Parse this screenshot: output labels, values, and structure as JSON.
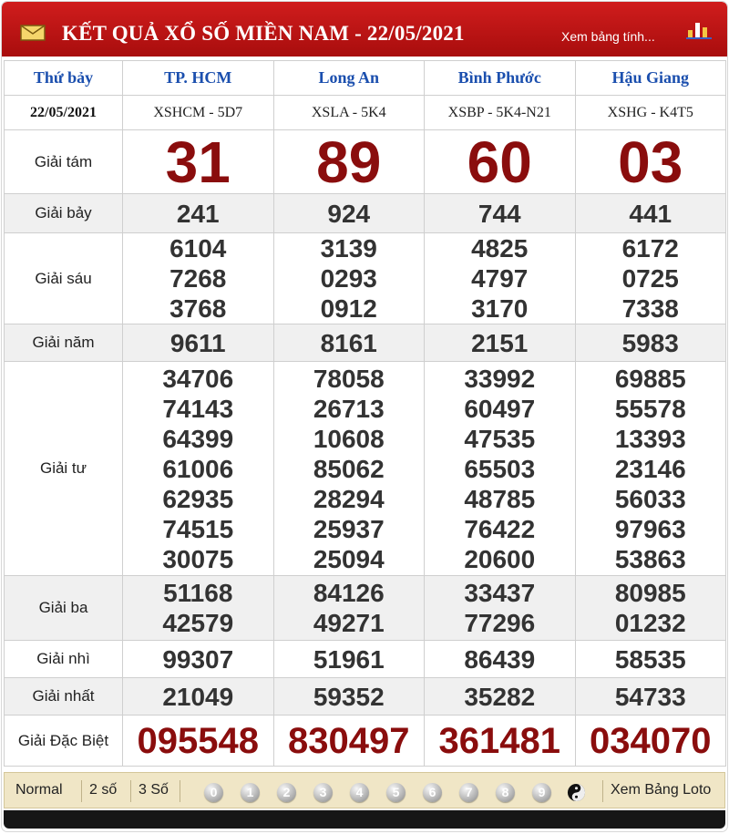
{
  "header": {
    "title": "KẾT QUẢ XỔ SỐ MIỀN NAM - 22/05/2021",
    "view_table": "Xem bảng tính...",
    "icons": [
      "mail-icon",
      "bar-chart-icon"
    ]
  },
  "columns": {
    "day": "Thứ bảy",
    "provinces": [
      "TP. HCM",
      "Long An",
      "Bình Phước",
      "Hậu Giang"
    ]
  },
  "codes": {
    "date": "22/05/2021",
    "tickets": [
      "XSHCM - 5D7",
      "XSLA - 5K4",
      "XSBP - 5K4-N21",
      "XSHG - K4T5"
    ]
  },
  "prizes": {
    "g8": {
      "label": "Giải tám",
      "values": [
        "31",
        "89",
        "60",
        "03"
      ]
    },
    "g7": {
      "label": "Giải bảy",
      "values": [
        "241",
        "924",
        "744",
        "441"
      ]
    },
    "g6": {
      "label": "Giải sáu",
      "values": [
        [
          "6104",
          "7268",
          "3768"
        ],
        [
          "3139",
          "0293",
          "0912"
        ],
        [
          "4825",
          "4797",
          "3170"
        ],
        [
          "6172",
          "0725",
          "7338"
        ]
      ]
    },
    "g5": {
      "label": "Giải năm",
      "values": [
        "9611",
        "8161",
        "2151",
        "5983"
      ]
    },
    "g4": {
      "label": "Giải tư",
      "values": [
        [
          "34706",
          "74143",
          "64399",
          "61006",
          "62935",
          "74515",
          "30075"
        ],
        [
          "78058",
          "26713",
          "10608",
          "85062",
          "28294",
          "25937",
          "25094"
        ],
        [
          "33992",
          "60497",
          "47535",
          "65503",
          "48785",
          "76422",
          "20600"
        ],
        [
          "69885",
          "55578",
          "13393",
          "23146",
          "56033",
          "97963",
          "53863"
        ]
      ]
    },
    "g3": {
      "label": "Giải ba",
      "values": [
        [
          "51168",
          "42579"
        ],
        [
          "84126",
          "49271"
        ],
        [
          "33437",
          "77296"
        ],
        [
          "80985",
          "01232"
        ]
      ]
    },
    "g2": {
      "label": "Giải nhì",
      "values": [
        "99307",
        "51961",
        "86439",
        "58535"
      ]
    },
    "g1": {
      "label": "Giải nhất",
      "values": [
        "21049",
        "59352",
        "35282",
        "54733"
      ]
    },
    "db": {
      "label": "Giải Đặc Biệt",
      "values": [
        "095548",
        "830497",
        "361481",
        "034070"
      ]
    }
  },
  "bottombar": {
    "modes": [
      "Normal",
      "2 số",
      "3 Số"
    ],
    "digits": [
      "0",
      "1",
      "2",
      "3",
      "4",
      "5",
      "6",
      "7",
      "8",
      "9"
    ],
    "view_loto": "Xem Bảng Loto"
  },
  "colors": {
    "header_red": "#c0161b",
    "prize_red": "#8a0d0d",
    "province_blue": "#1b4fae",
    "bottombar_bg": "#f0e6c6"
  }
}
